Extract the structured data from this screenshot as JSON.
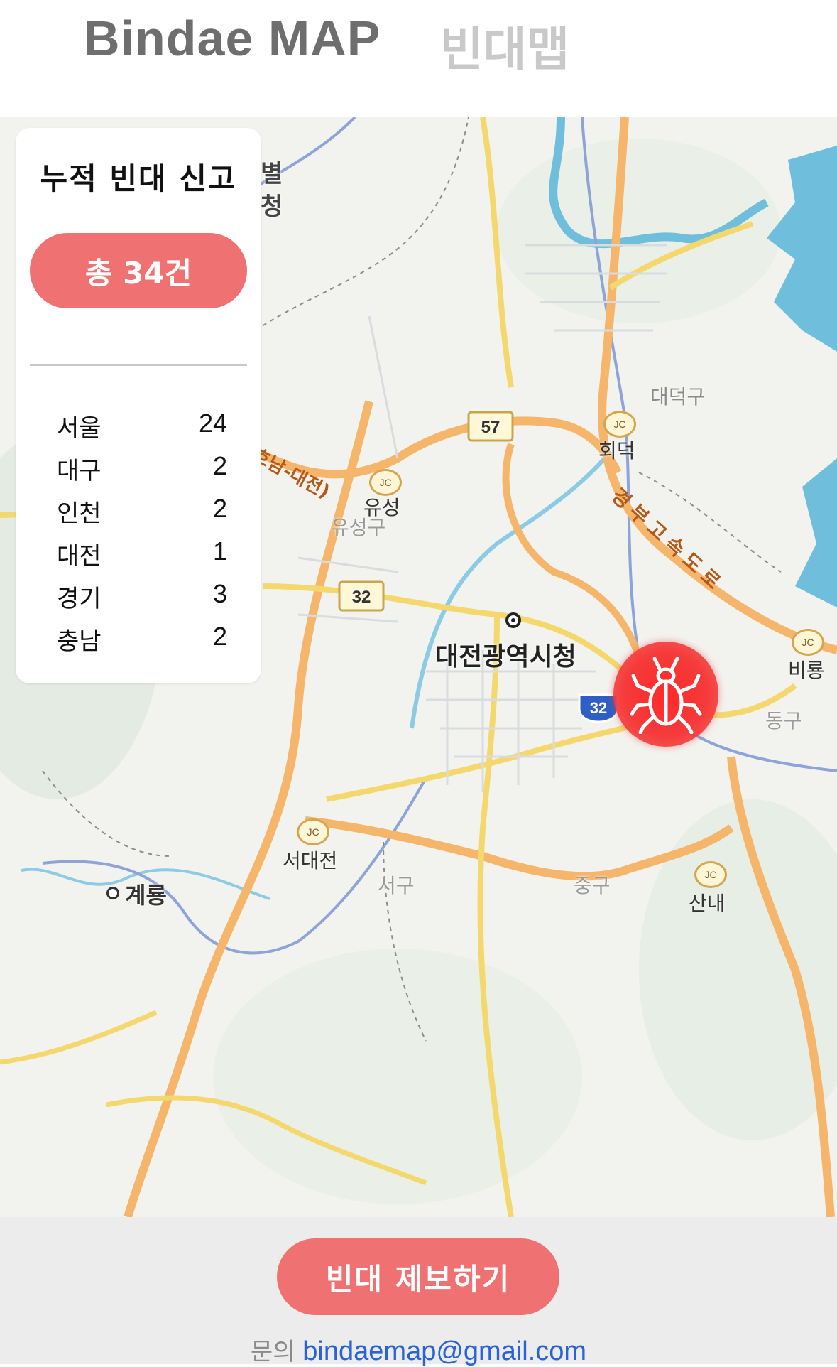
{
  "header": {
    "title_en": "Bindae MAP",
    "title_ko": "빈대맵"
  },
  "summary": {
    "title": "누적 빈대 신고",
    "total_label": "총 34건",
    "regions": [
      {
        "name": "서울",
        "count": "24"
      },
      {
        "name": "대구",
        "count": "2"
      },
      {
        "name": "인천",
        "count": "2"
      },
      {
        "name": "대전",
        "count": "1"
      },
      {
        "name": "경기",
        "count": "3"
      },
      {
        "name": "충남",
        "count": "2"
      }
    ]
  },
  "map": {
    "labels": {
      "city_hall": "대전광역시청",
      "daedeok": "대덕구",
      "hoedeok": "회덕",
      "yuseong": "유성",
      "yuseong_gu": "유성구",
      "seodaejeon": "서대전",
      "seo_gu": "서구",
      "jung_gu": "중구",
      "sannae": "산내",
      "dong_gu": "동구",
      "biryong": "비룡",
      "gyeryong": "계룡",
      "expressway": "경부고속도로",
      "honam": "(호남-대전)",
      "byeol": "별",
      "cheong": "청",
      "jc": "JC",
      "route_57": "57",
      "route_32": "32"
    },
    "marker_icon": "bedbug-icon",
    "marker_color": "#f53a3a"
  },
  "footer": {
    "report_button": "빈대 제보하기",
    "contact_label": "문의",
    "contact_email": "bindaemap@gmail.com"
  },
  "colors": {
    "accent": "#f07172",
    "title_gray": "#6e6e6e",
    "email_blue": "#2a63d6"
  }
}
